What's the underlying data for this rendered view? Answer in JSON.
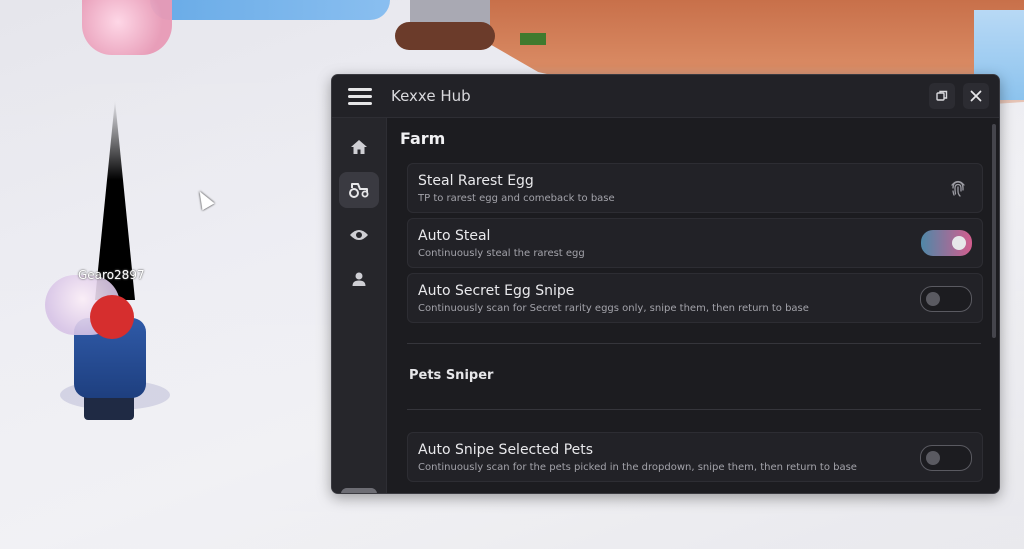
{
  "world": {
    "player_name": "Gearo2897"
  },
  "hub": {
    "title": "Kexxe Hub",
    "sidebar": [
      "home-icon",
      "tractor-icon",
      "eye-icon",
      "user-icon"
    ],
    "active_sidebar_item": "tractor-icon",
    "section_title": "Farm",
    "items": [
      {
        "title": "Steal Rarest Egg",
        "desc": "TP to rarest egg and comeback to base",
        "control": "button",
        "icon": "fingerprint-icon"
      },
      {
        "title": "Auto Steal",
        "desc": "Continuously steal the rarest egg",
        "control": "toggle",
        "on": true
      },
      {
        "title": "Auto Secret Egg Snipe",
        "desc": "Continuously scan for Secret rarity eggs only, snipe them, then return to base",
        "control": "toggle",
        "on": false
      }
    ],
    "subsection_title": "Pets Sniper",
    "sniper_items": [
      {
        "title": "Auto Snipe Selected Pets",
        "desc": "Continuously scan for the pets picked in the dropdown, snipe them, then return to base",
        "control": "toggle",
        "on": false
      }
    ],
    "colors": {
      "background": "#1c1c20",
      "card": "#222227",
      "toggle_gradient_start": "#4f88a8",
      "toggle_gradient_end": "#d35d8e"
    }
  }
}
